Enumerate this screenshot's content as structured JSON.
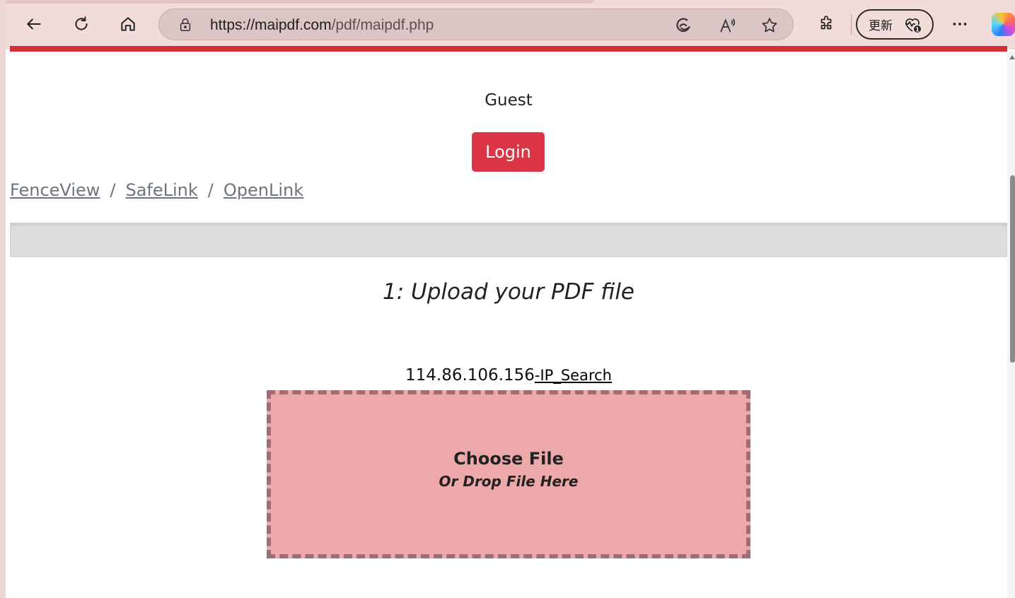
{
  "browser": {
    "url_host": "https://maipdf.com",
    "url_path": "/pdf/maipdf.php",
    "update_label": "更新",
    "icons": {
      "back": "back-arrow-icon",
      "refresh": "refresh-icon",
      "home": "home-icon",
      "lock": "lock-icon",
      "edge": "edge-icon",
      "read_aloud": "read-aloud-icon",
      "favorite": "star-icon",
      "extensions": "puzzle-icon",
      "health": "heart-monitor-icon",
      "more": "more-dots-icon",
      "copilot": "copilot-icon"
    }
  },
  "header": {
    "user_label": "Guest",
    "login_label": "Login"
  },
  "breadcrumbs": {
    "items": [
      "FenceView",
      "SafeLink",
      "OpenLink"
    ],
    "separator": "/"
  },
  "upload": {
    "step_title": "1: Upload your PDF file",
    "ip_address": "114.86.106.156",
    "ip_search_label": "-IP_Search",
    "dropzone_title": "Choose File",
    "dropzone_subtitle": "Or Drop File Here"
  },
  "colors": {
    "accent_red": "#dc3545",
    "dropzone_fill": "#eda9aa",
    "dropzone_border": "#a06e72"
  }
}
